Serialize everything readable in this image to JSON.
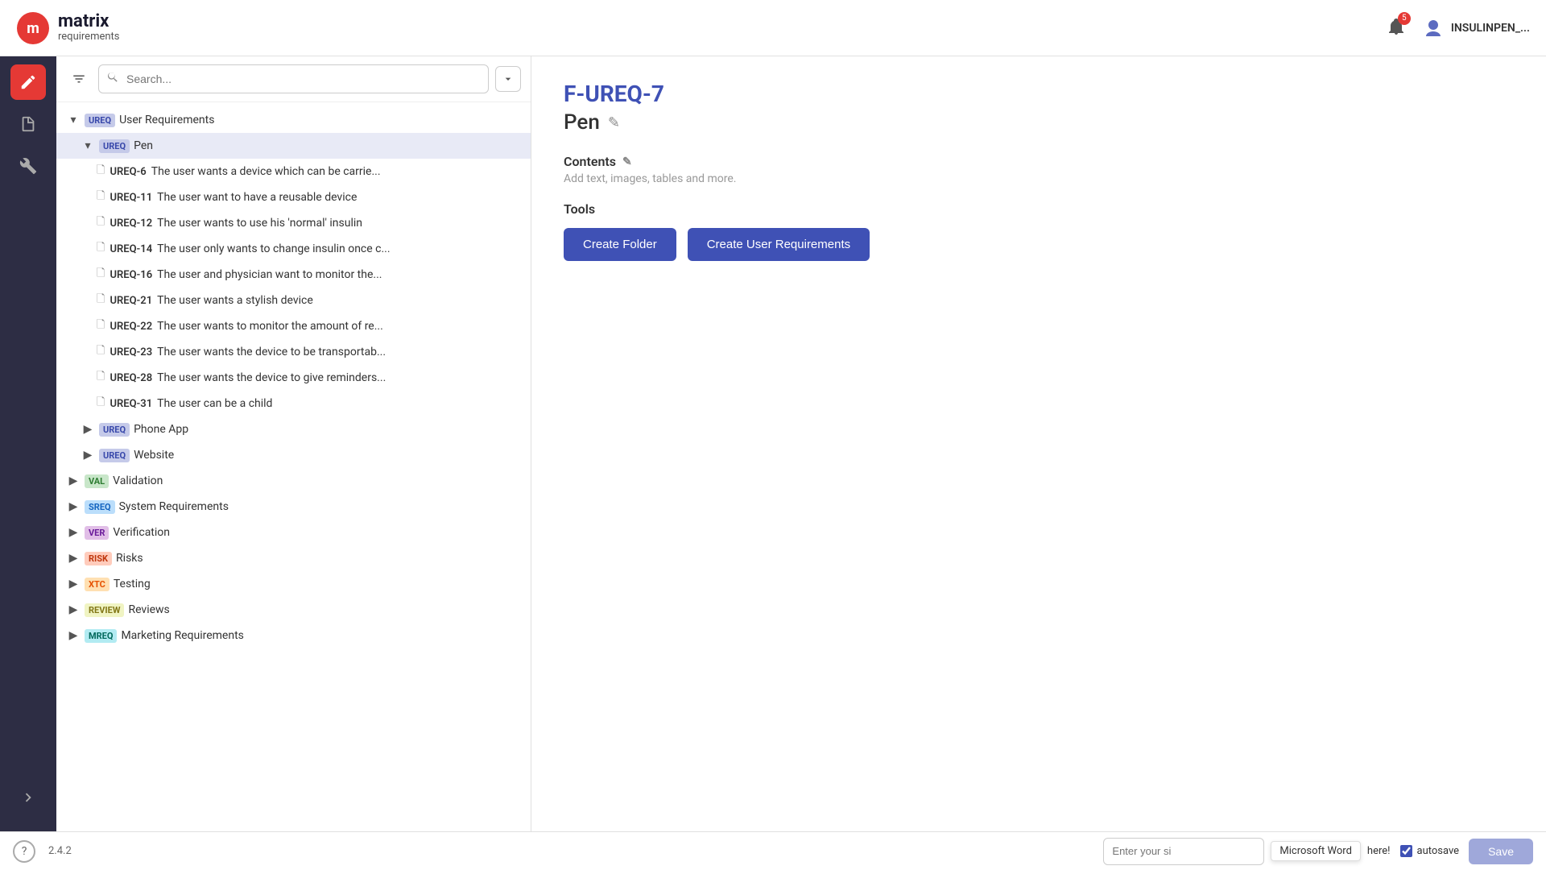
{
  "app": {
    "name": "matrix",
    "sub": "requirements"
  },
  "topbar": {
    "notification_count": "5",
    "user_name": "INSULINPEN_..."
  },
  "toolbar": {
    "search_placeholder": "Search..."
  },
  "tree": {
    "items": [
      {
        "id": "ureq-root",
        "level": 0,
        "chevron": "down",
        "tag": "UREQ",
        "tag_class": "tag-ureq",
        "label": "User Requirements",
        "selected": false
      },
      {
        "id": "ureq-pen",
        "level": 1,
        "chevron": "down",
        "tag": "UREQ",
        "tag_class": "tag-ureq",
        "label": "Pen",
        "selected": true
      },
      {
        "id": "ureq-6",
        "level": 2,
        "chevron": null,
        "tag": null,
        "code": "UREQ-6",
        "label": "The user wants a device which can be carrie...",
        "selected": false
      },
      {
        "id": "ureq-11",
        "level": 2,
        "chevron": null,
        "tag": null,
        "code": "UREQ-11",
        "label": "The user want to have a reusable device",
        "selected": false
      },
      {
        "id": "ureq-12",
        "level": 2,
        "chevron": null,
        "tag": null,
        "code": "UREQ-12",
        "label": "The user wants to use his 'normal' insulin",
        "selected": false
      },
      {
        "id": "ureq-14",
        "level": 2,
        "chevron": null,
        "tag": null,
        "code": "UREQ-14",
        "label": "The user only wants to change insulin once c...",
        "selected": false
      },
      {
        "id": "ureq-16",
        "level": 2,
        "chevron": null,
        "tag": null,
        "code": "UREQ-16",
        "label": "The user and physician want to monitor the...",
        "selected": false
      },
      {
        "id": "ureq-21",
        "level": 2,
        "chevron": null,
        "tag": null,
        "code": "UREQ-21",
        "label": "The user wants a stylish device",
        "selected": false
      },
      {
        "id": "ureq-22",
        "level": 2,
        "chevron": null,
        "tag": null,
        "code": "UREQ-22",
        "label": "The user wants to monitor the amount of re...",
        "selected": false
      },
      {
        "id": "ureq-23",
        "level": 2,
        "chevron": null,
        "tag": null,
        "code": "UREQ-23",
        "label": "The user wants the device to be transportab...",
        "selected": false
      },
      {
        "id": "ureq-28",
        "level": 2,
        "chevron": null,
        "tag": null,
        "code": "UREQ-28",
        "label": "The user wants the device to give reminders...",
        "selected": false
      },
      {
        "id": "ureq-31",
        "level": 2,
        "chevron": null,
        "tag": null,
        "code": "UREQ-31",
        "label": "The user can be a child",
        "selected": false
      },
      {
        "id": "ureq-phone",
        "level": 1,
        "chevron": "right",
        "tag": "UREQ",
        "tag_class": "tag-ureq",
        "label": "Phone App",
        "selected": false
      },
      {
        "id": "ureq-web",
        "level": 1,
        "chevron": "right",
        "tag": "UREQ",
        "tag_class": "tag-ureq",
        "label": "Website",
        "selected": false
      },
      {
        "id": "val-root",
        "level": 0,
        "chevron": "right",
        "tag": "VAL",
        "tag_class": "tag-val",
        "label": "Validation",
        "selected": false
      },
      {
        "id": "sreq-root",
        "level": 0,
        "chevron": "right",
        "tag": "SREQ",
        "tag_class": "tag-sreq",
        "label": "System Requirements",
        "selected": false
      },
      {
        "id": "ver-root",
        "level": 0,
        "chevron": "right",
        "tag": "VER",
        "tag_class": "tag-ver",
        "label": "Verification",
        "selected": false
      },
      {
        "id": "risk-root",
        "level": 0,
        "chevron": "right",
        "tag": "RISK",
        "tag_class": "tag-risk",
        "label": "Risks",
        "selected": false
      },
      {
        "id": "xtc-root",
        "level": 0,
        "chevron": "right",
        "tag": "XTC",
        "tag_class": "tag-xtc",
        "label": "Testing",
        "selected": false
      },
      {
        "id": "review-root",
        "level": 0,
        "chevron": "right",
        "tag": "REVIEW",
        "tag_class": "tag-review",
        "label": "Reviews",
        "selected": false
      },
      {
        "id": "mreq-root",
        "level": 0,
        "chevron": "right",
        "tag": "MREQ",
        "tag_class": "tag-mreq",
        "label": "Marketing Requirements",
        "selected": false
      }
    ]
  },
  "content": {
    "item_id": "F-UREQ-7",
    "item_title": "Pen",
    "contents_label": "Contents",
    "contents_hint": "Add text, images, tables and more.",
    "tools_label": "Tools",
    "btn_create_folder": "Create Folder",
    "btn_create_ureq": "Create User Requirements"
  },
  "bottombar": {
    "version": "2.4.2",
    "input_placeholder": "Enter your si",
    "msword_tooltip": "Microsoft Word",
    "input_suffix": "here!",
    "autosave_label": "autosave",
    "save_label": "Save"
  }
}
